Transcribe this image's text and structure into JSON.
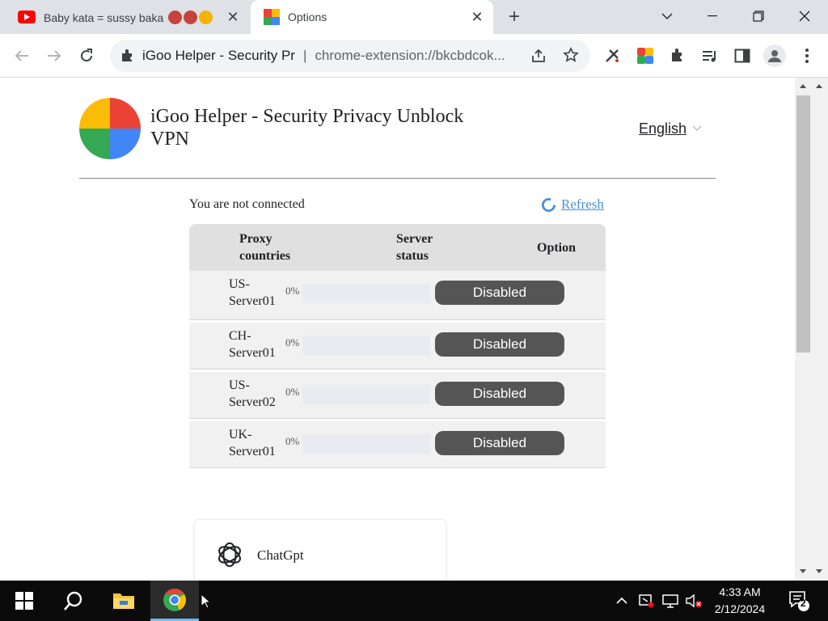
{
  "browser": {
    "tabs": [
      {
        "title": "Baby kata = sussy baka",
        "active": false
      },
      {
        "title": "Options",
        "active": true
      }
    ],
    "omnibox": {
      "site_name": "iGoo Helper - Security Pr",
      "url": "chrome-extension://bkcbdcok..."
    }
  },
  "page": {
    "app_title": "iGoo Helper - Security Privacy Unblock VPN",
    "language": "English",
    "connection_status": "You are not connected",
    "refresh_label": "Refresh",
    "table": {
      "headers": [
        "Proxy countries",
        "Server status",
        "Option"
      ],
      "rows": [
        {
          "server": "US-Server01",
          "percent": "0%",
          "load": 0,
          "option": "Disabled"
        },
        {
          "server": "CH-Server01",
          "percent": "0%",
          "load": 0,
          "option": "Disabled"
        },
        {
          "server": "US-Server02",
          "percent": "0%",
          "load": 0,
          "option": "Disabled"
        },
        {
          "server": "UK-Server01",
          "percent": "0%",
          "load": 0,
          "option": "Disabled"
        }
      ]
    },
    "card": {
      "label": "ChatGpt"
    }
  },
  "taskbar": {
    "time": "4:33 AM",
    "date": "2/12/2024",
    "notification_count": "2"
  },
  "colors": {
    "accent": "#1a73e8",
    "button_bg": "#555555",
    "logo": [
      "#fbbc05",
      "#ea4335",
      "#34a853",
      "#4285f4"
    ]
  }
}
